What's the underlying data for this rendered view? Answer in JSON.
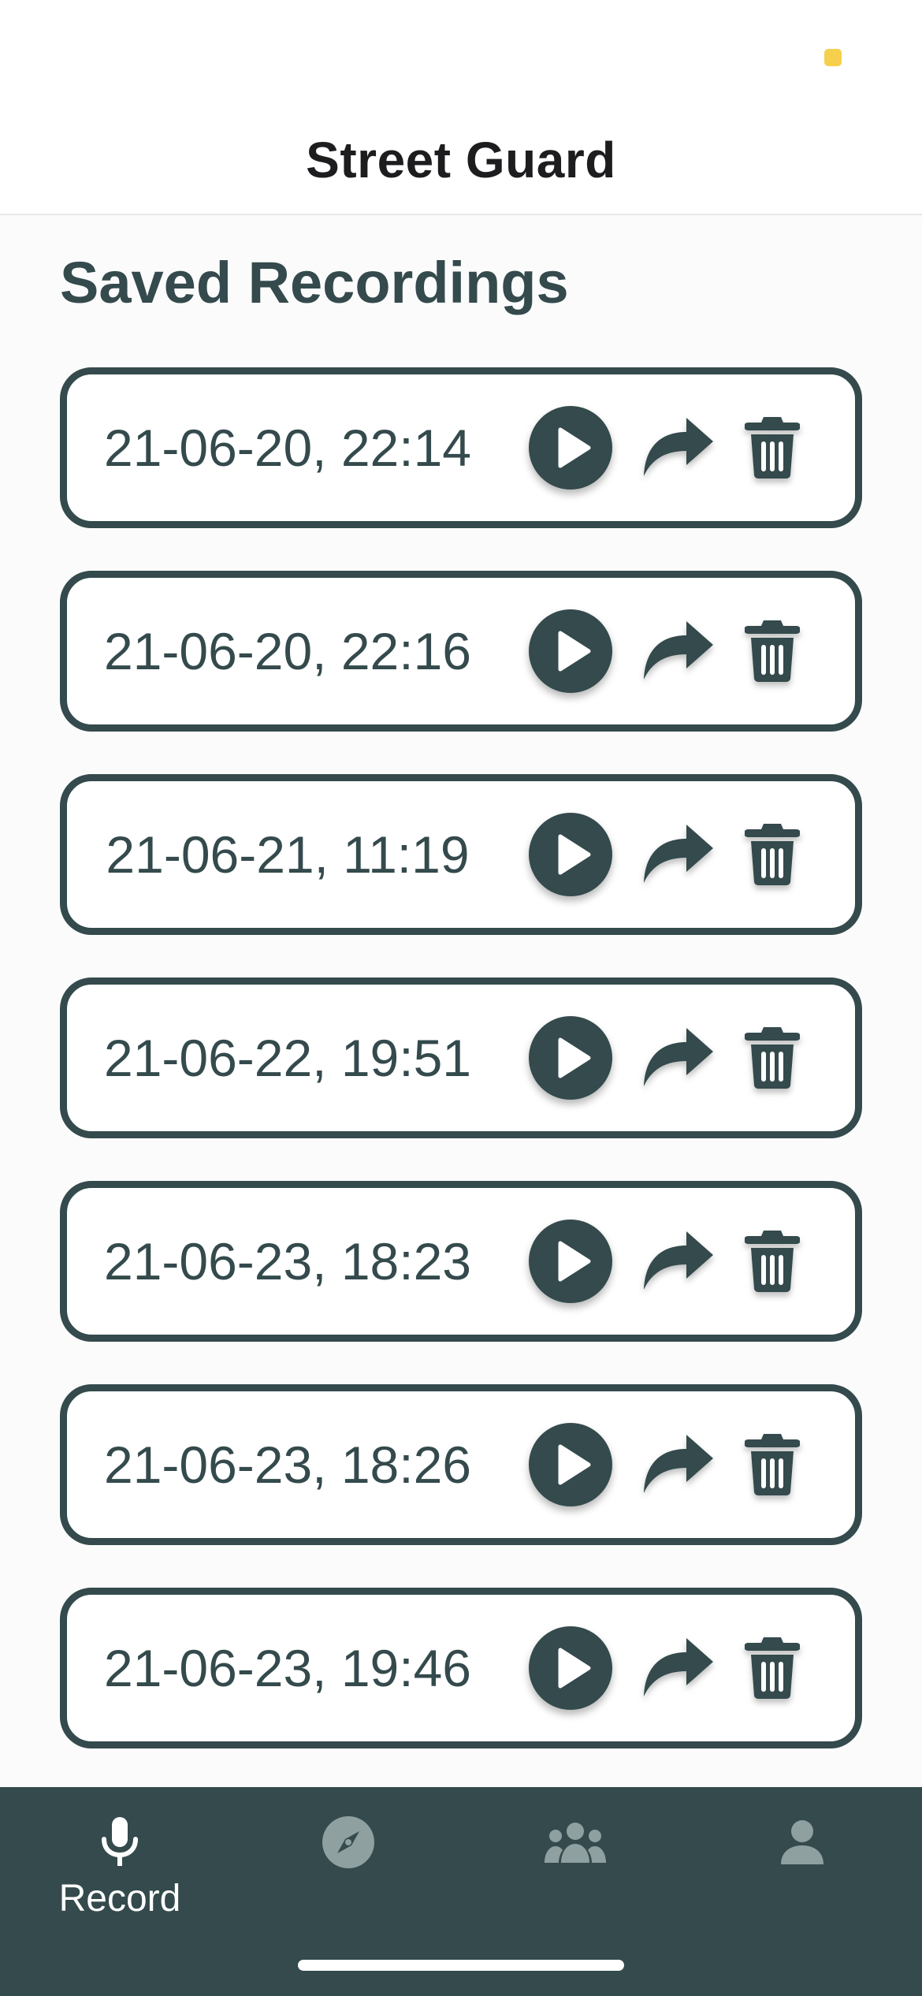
{
  "app": {
    "title": "Street Guard"
  },
  "main": {
    "section_title": "Saved Recordings",
    "recordings": [
      {
        "date": "21-06-20, 22:14"
      },
      {
        "date": "21-06-20, 22:16"
      },
      {
        "date": "21-06-21, 11:19"
      },
      {
        "date": "21-06-22, 19:51"
      },
      {
        "date": "21-06-23, 18:23"
      },
      {
        "date": "21-06-23, 18:26"
      },
      {
        "date": "21-06-23, 19:46"
      }
    ],
    "actions": {
      "play_icon": "play-icon",
      "share_icon": "share-arrow-icon",
      "delete_icon": "trash-icon"
    }
  },
  "tab_bar": {
    "tabs": [
      {
        "label": "Record",
        "icon": "microphone-icon",
        "active": true
      },
      {
        "label": "",
        "icon": "compass-icon",
        "active": false
      },
      {
        "label": "",
        "icon": "group-icon",
        "active": false
      },
      {
        "label": "",
        "icon": "user-icon",
        "active": false
      }
    ]
  },
  "colors": {
    "primary": "#344a4c",
    "background": "#fbfbfc",
    "status_dot": "#f6d04d",
    "inactive_tab_icon": "#8fa0a1",
    "active_tab": "#ffffff"
  }
}
